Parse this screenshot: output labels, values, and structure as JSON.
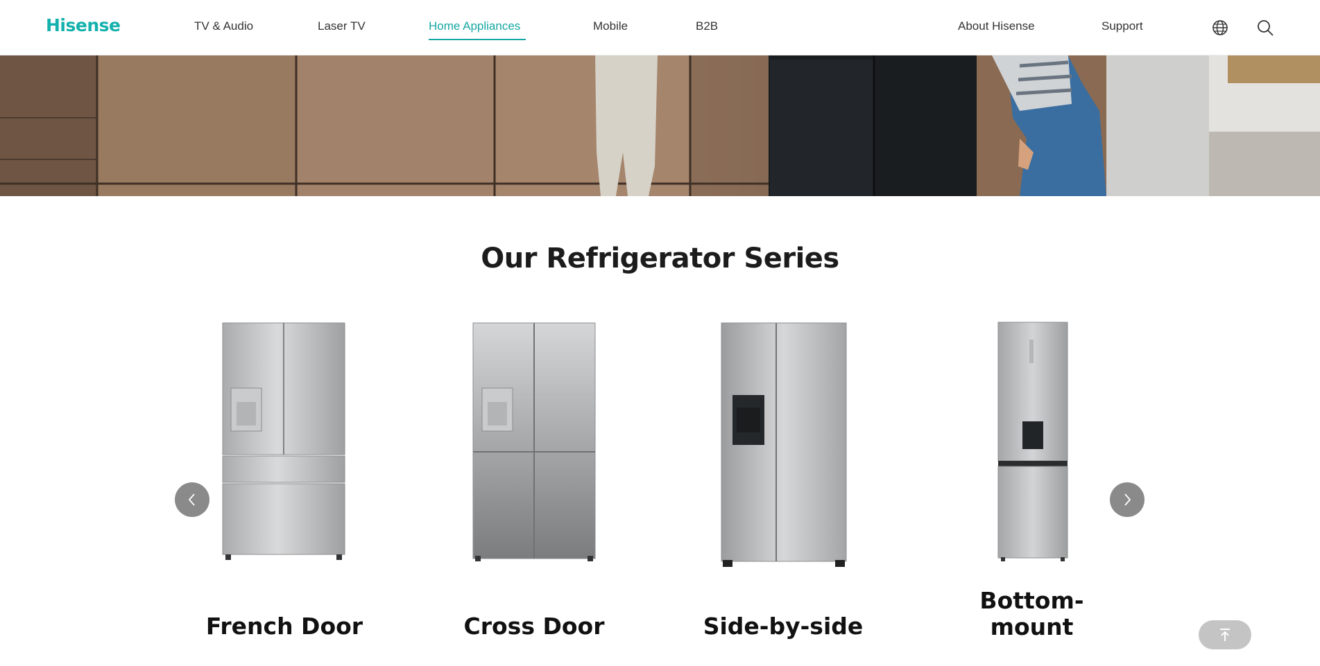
{
  "header": {
    "logo": "Hisense",
    "nav": [
      {
        "label": "TV & Audio"
      },
      {
        "label": "Laser TV"
      },
      {
        "label": "Home Appliances",
        "active": true
      },
      {
        "label": "Mobile"
      },
      {
        "label": "B2B"
      },
      {
        "label": "About Hisense"
      },
      {
        "label": "Support"
      }
    ],
    "icons": [
      "globe-icon",
      "search-icon"
    ]
  },
  "hero": {
    "slides_count": 3,
    "active_slide": 3
  },
  "section": {
    "title": "Our Refrigerator Series"
  },
  "series": [
    {
      "name": "French Door"
    },
    {
      "name": "Cross Door"
    },
    {
      "name": "Side-by-side"
    },
    {
      "name": "Bottom-mount"
    }
  ],
  "colors": {
    "accent": "#15a7a3",
    "arrow_bg": "#8a8a8a",
    "back_to_top_bg": "#c4c4c4"
  }
}
